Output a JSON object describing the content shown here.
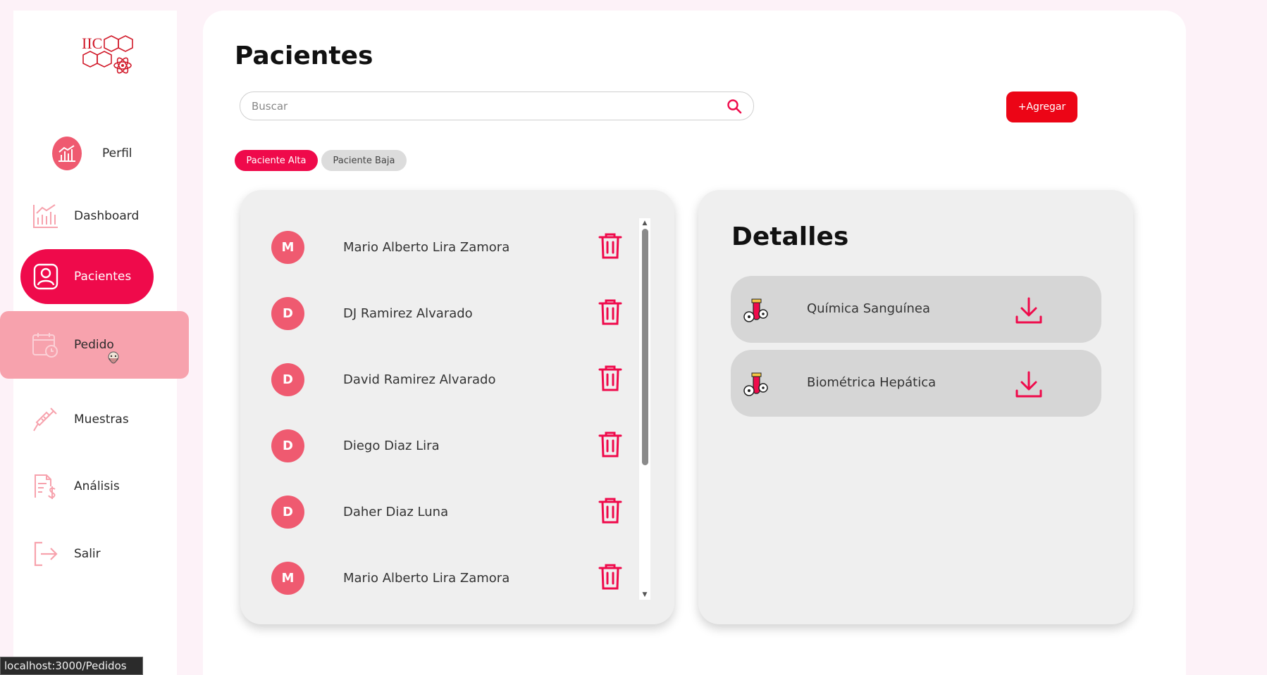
{
  "sidebar": {
    "logo_text": "IIC",
    "items": [
      {
        "label": "Perfil",
        "icon": "profile-chart-icon"
      },
      {
        "label": "Dashboard",
        "icon": "chart-icon"
      },
      {
        "label": "Pacientes",
        "icon": "user-card-icon"
      },
      {
        "label": "Pedido",
        "icon": "calendar-clock-icon"
      },
      {
        "label": "Muestras",
        "icon": "syringe-icon"
      },
      {
        "label": "Análisis",
        "icon": "invoice-dollar-icon"
      },
      {
        "label": "Salir",
        "icon": "logout-icon"
      }
    ]
  },
  "main": {
    "title": "Pacientes",
    "search_placeholder": "Buscar",
    "add_button": "+Agregar",
    "chips": {
      "alta": "Paciente Alta",
      "baja": "Paciente Baja"
    },
    "patients": [
      {
        "initial": "M",
        "name": "Mario Alberto Lira Zamora"
      },
      {
        "initial": "D",
        "name": "DJ Ramirez Alvarado"
      },
      {
        "initial": "D",
        "name": "David Ramirez Alvarado"
      },
      {
        "initial": "D",
        "name": "Diego Diaz Lira"
      },
      {
        "initial": "D",
        "name": "Daher Diaz Luna"
      },
      {
        "initial": "M",
        "name": "Mario Alberto Lira Zamora"
      }
    ],
    "details": {
      "title": "Detalles",
      "items": [
        {
          "name": "Química Sanguínea"
        },
        {
          "name": "Biométrica Hepática"
        }
      ]
    }
  },
  "status_bar": {
    "url": "localhost:3000/Pedidos"
  },
  "colors": {
    "accent": "#ef0a4b",
    "avatar": "#ef5a70",
    "hover": "#f7a2ad",
    "add": "#ec0516"
  }
}
